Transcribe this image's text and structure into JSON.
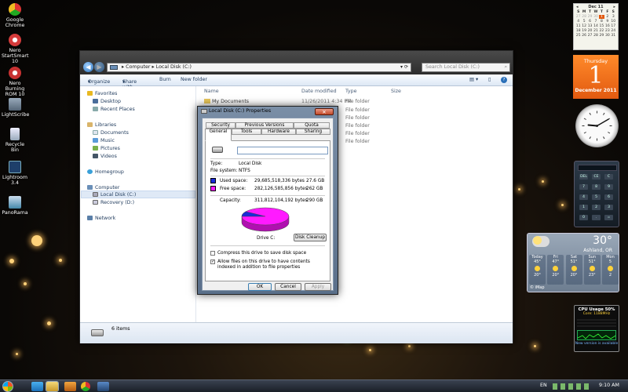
{
  "desktop": {
    "icons": [
      {
        "label": "Google Chrome",
        "color": "#e8b321"
      },
      {
        "label": "Nero StartSmart 10",
        "color": "#d43b3b"
      },
      {
        "label": "Nero Burning ROM 10",
        "color": "#c83232"
      },
      {
        "label": "LightScribe",
        "color": "#6a7fa0"
      },
      {
        "label": "Recycle Bin",
        "color": "#c0c8d0"
      },
      {
        "label": "Lightroom 3.4",
        "color": "#2a5a90"
      },
      {
        "label": "PanoRama",
        "color": "#5a8ac8"
      }
    ]
  },
  "explorer": {
    "address": {
      "part1": "Computer",
      "part2": "Local Disk (C:)"
    },
    "search_placeholder": "Search Local Disk (C:)",
    "toolbar": {
      "organize": "Organize",
      "share_with": "Share with",
      "burn": "Burn",
      "new_folder": "New folder"
    },
    "nav": {
      "favorites": "Favorites",
      "desktop": "Desktop",
      "recent_places": "Recent Places",
      "libraries": "Libraries",
      "documents": "Documents",
      "music": "Music",
      "pictures": "Pictures",
      "videos": "Videos",
      "homegroup": "Homegroup",
      "computer": "Computer",
      "local_disk": "Local Disk (C:)",
      "recovery": "Recovery (D:)",
      "network": "Network"
    },
    "columns": {
      "name": "Name",
      "date_modified": "Date modified",
      "type": "Type",
      "size": "Size"
    },
    "first_row": {
      "name": "My Documents",
      "date": "11/26/2011 4:34 PM",
      "type": "File folder"
    },
    "other_types": [
      "File folder",
      "File folder",
      "File folder",
      "File folder",
      "File folder"
    ],
    "status": "6 items"
  },
  "dialog": {
    "title": "Local Disk (C:) Properties",
    "close": "✕",
    "tabs_top": [
      "Security",
      "Previous Versions",
      "Quota"
    ],
    "tabs_bottom": [
      "General",
      "Tools",
      "Hardware",
      "Sharing"
    ],
    "drive_label_value": "",
    "type_label": "Type:",
    "type_value": "Local Disk",
    "fs_label": "File system:",
    "fs_value": "NTFS",
    "used_label": "Used space:",
    "used_bytes": "29,685,518,336 bytes",
    "used_gb": "27.6 GB",
    "free_label": "Free space:",
    "free_bytes": "282,126,585,856 bytes",
    "free_gb": "262 GB",
    "capacity_label": "Capacity:",
    "capacity_bytes": "311,812,104,192 bytes",
    "capacity_gb": "290 GB",
    "drive_caption": "Drive C:",
    "disk_cleanup": "Disk Cleanup",
    "compress_label": "Compress this drive to save disk space",
    "index_label": "Allow files on this drive to have contents indexed in addition to file properties",
    "ok": "OK",
    "cancel": "Cancel",
    "apply": "Apply",
    "used_color": "#1a2bd8",
    "free_color": "#ff1aff",
    "used_fraction": 0.095
  },
  "calendar": {
    "month_year": "Dec 11",
    "weekday": "Thursday",
    "day": "1",
    "month_full": "December 2011",
    "days_header": [
      "S",
      "M",
      "T",
      "W",
      "T",
      "F",
      "S"
    ],
    "grid": [
      "27",
      "28",
      "29",
      "30",
      "1",
      "2",
      "3",
      "4",
      "5",
      "6",
      "7",
      "8",
      "9",
      "10",
      "11",
      "12",
      "13",
      "14",
      "15",
      "16",
      "17",
      "18",
      "19",
      "20",
      "21",
      "22",
      "23",
      "24",
      "25",
      "26",
      "27",
      "28",
      "29",
      "30",
      "31"
    ]
  },
  "clock": {
    "hour": 9,
    "minute": 10
  },
  "calculator": {
    "keys": [
      "DEL",
      "CE",
      "C",
      "7",
      "8",
      "9",
      "4",
      "5",
      "6",
      "1",
      "2",
      "3",
      "0",
      ".",
      "="
    ]
  },
  "weather": {
    "temp": "30°",
    "location": "Ashland, OR",
    "days": [
      {
        "name": "Today",
        "high": "45°",
        "low": "20°"
      },
      {
        "name": "Fri",
        "high": "47°",
        "low": "20°"
      },
      {
        "name": "Sat",
        "high": "51°",
        "low": "20°"
      },
      {
        "name": "Sun",
        "high": "51°",
        "low": "23°"
      },
      {
        "name": "Mon",
        "high": "5",
        "low": "2"
      }
    ],
    "source": "© iMap"
  },
  "cpu_gadget": {
    "title": "CPU Usage 50%",
    "core_line": "Core: 1188MHz",
    "footer": "New version is available"
  },
  "taskbar": {
    "lang": "EN",
    "time": "9:10 AM"
  }
}
